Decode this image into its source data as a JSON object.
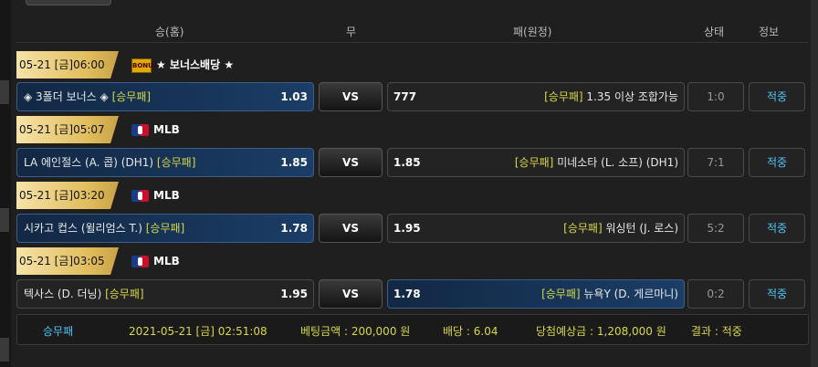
{
  "header": {
    "home": "승(홈)",
    "draw": "무",
    "away": "패(원정)",
    "status": "상태",
    "info": "정보"
  },
  "matches": [
    {
      "datetime": "05-21 [금]06:00",
      "league": "★ 보너스배당 ★",
      "league_icon": "bonus-icon",
      "home": {
        "name": "◈ 3폴더 보너스 ◈",
        "type": "[승무패]",
        "odds": "1.03"
      },
      "vs": "VS",
      "away": {
        "name": "1.35 이상 조합가능",
        "type": "[승무패]",
        "odds": "777"
      },
      "score": "1:0",
      "info": "적중",
      "selected": "home"
    },
    {
      "datetime": "05-21 [금]05:07",
      "league": "MLB",
      "league_icon": "mlb-icon",
      "home": {
        "name": "LA 에인절스 (A. 콥) (DH1)",
        "type": "[승무패]",
        "odds": "1.85"
      },
      "vs": "VS",
      "away": {
        "name": "미네소타 (L. 소프) (DH1)",
        "type": "[승무패]",
        "odds": "1.85"
      },
      "score": "7:1",
      "info": "적중",
      "selected": "home"
    },
    {
      "datetime": "05-21 [금]03:20",
      "league": "MLB",
      "league_icon": "mlb-icon",
      "home": {
        "name": "시카고 컵스 (윌리엄스 T.)",
        "type": "[승무패]",
        "odds": "1.78"
      },
      "vs": "VS",
      "away": {
        "name": "워싱턴 (J. 로스)",
        "type": "[승무패]",
        "odds": "1.95"
      },
      "score": "5:2",
      "info": "적중",
      "selected": "home"
    },
    {
      "datetime": "05-21 [금]03:05",
      "league": "MLB",
      "league_icon": "mlb-icon",
      "home": {
        "name": "텍사스 (D. 더닝)",
        "type": "[승무패]",
        "odds": "1.95"
      },
      "vs": "VS",
      "away": {
        "name": "뉴욕Y (D. 게르마니)",
        "type": "[승무패]",
        "odds": "1.78"
      },
      "score": "0:2",
      "info": "적중",
      "selected": "away"
    }
  ],
  "summary": {
    "type": "승무패",
    "datetime": "2021-05-21 [금] 02:51:08",
    "bet_amount": "베팅금액 : 200,000 원",
    "odds": "배당 : 6.04",
    "expected_win": "당첨예상금 : 1,208,000 원",
    "result": "결과 : 적중"
  },
  "colors": {
    "accent_blue": "#4fc3f7",
    "bet_type_yellow": "#d8d84a",
    "date_gold": "#e0bd5d"
  }
}
